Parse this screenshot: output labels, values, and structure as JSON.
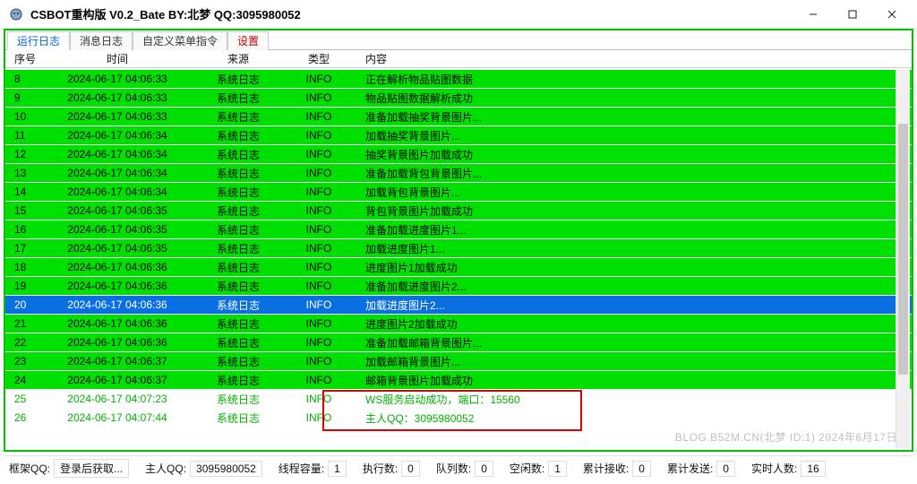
{
  "title": "CSBOT重构版  V0.2_Bate BY:北梦 QQ:3095980052",
  "tabs": [
    {
      "label": "运行日志",
      "active": true
    },
    {
      "label": "消息日志"
    },
    {
      "label": "自定义菜单指令"
    },
    {
      "label": "设置",
      "red": true
    }
  ],
  "columns": {
    "seq": "序号",
    "time": "时间",
    "src": "来源",
    "type": "类型",
    "msg": "内容"
  },
  "logs": [
    {
      "seq": "8",
      "time": "2024-06-17 04:06:33",
      "src": "系统日志",
      "type": "INFO",
      "msg": "正在解析物品贴图数据"
    },
    {
      "seq": "9",
      "time": "2024-06-17 04:06:33",
      "src": "系统日志",
      "type": "INFO",
      "msg": "物品贴图数据解析成功"
    },
    {
      "seq": "10",
      "time": "2024-06-17 04:06:33",
      "src": "系统日志",
      "type": "INFO",
      "msg": "准备加载抽奖背景图片..."
    },
    {
      "seq": "11",
      "time": "2024-06-17 04:06:34",
      "src": "系统日志",
      "type": "INFO",
      "msg": "加载抽奖背景图片..."
    },
    {
      "seq": "12",
      "time": "2024-06-17 04:06:34",
      "src": "系统日志",
      "type": "INFO",
      "msg": "抽奖背景图片加载成功"
    },
    {
      "seq": "13",
      "time": "2024-06-17 04:06:34",
      "src": "系统日志",
      "type": "INFO",
      "msg": "准备加载背包背景图片..."
    },
    {
      "seq": "14",
      "time": "2024-06-17 04:06:34",
      "src": "系统日志",
      "type": "INFO",
      "msg": "加载背包背景图片..."
    },
    {
      "seq": "15",
      "time": "2024-06-17 04:06:35",
      "src": "系统日志",
      "type": "INFO",
      "msg": "背包背景图片加载成功"
    },
    {
      "seq": "16",
      "time": "2024-06-17 04:06:35",
      "src": "系统日志",
      "type": "INFO",
      "msg": "准备加载进度图片1..."
    },
    {
      "seq": "17",
      "time": "2024-06-17 04:06:35",
      "src": "系统日志",
      "type": "INFO",
      "msg": "加载进度图片1..."
    },
    {
      "seq": "18",
      "time": "2024-06-17 04:06:36",
      "src": "系统日志",
      "type": "INFO",
      "msg": "进度图片1加载成功"
    },
    {
      "seq": "19",
      "time": "2024-06-17 04:06:36",
      "src": "系统日志",
      "type": "INFO",
      "msg": "准备加载进度图片2..."
    },
    {
      "seq": "20",
      "time": "2024-06-17 04:06:36",
      "src": "系统日志",
      "type": "INFO",
      "msg": "加载进度图片2...",
      "selected": true
    },
    {
      "seq": "21",
      "time": "2024-06-17 04:06:36",
      "src": "系统日志",
      "type": "INFO",
      "msg": "进度图片2加载成功"
    },
    {
      "seq": "22",
      "time": "2024-06-17 04:06:36",
      "src": "系统日志",
      "type": "INFO",
      "msg": "准备加载邮箱背景图片..."
    },
    {
      "seq": "23",
      "time": "2024-06-17 04:06:37",
      "src": "系统日志",
      "type": "INFO",
      "msg": "加载邮箱背景图片..."
    },
    {
      "seq": "24",
      "time": "2024-06-17 04:06:37",
      "src": "系统日志",
      "type": "INFO",
      "msg": "邮箱背景图片加载成功"
    },
    {
      "seq": "25",
      "time": "2024-06-17 04:07:23",
      "src": "系统日志",
      "type": "INFO",
      "msg": "WS服务启动成功，端口：15560",
      "whiteBG": true
    },
    {
      "seq": "26",
      "time": "2024-06-17 04:07:44",
      "src": "系统日志",
      "type": "INFO",
      "msg": "主人QQ：3095980052",
      "whiteBG": true
    }
  ],
  "watermark": "BLOG.B52M.CN(北梦 ID:1) 2024年6月17日",
  "status": {
    "frameQQ": {
      "label": "框架QQ:",
      "value": "登录后获取..."
    },
    "masterQQ": {
      "label": "主人QQ:",
      "value": "3095980052"
    },
    "threadCap": {
      "label": "线程容量:",
      "value": "1"
    },
    "exec": {
      "label": "执行数:",
      "value": "0"
    },
    "queue": {
      "label": "队列数:",
      "value": "0"
    },
    "idle": {
      "label": "空闲数:",
      "value": "1"
    },
    "recv": {
      "label": "累计接收:",
      "value": "0"
    },
    "send": {
      "label": "累计发送:",
      "value": "0"
    },
    "online": {
      "label": "实时人数:",
      "value": "16"
    }
  }
}
